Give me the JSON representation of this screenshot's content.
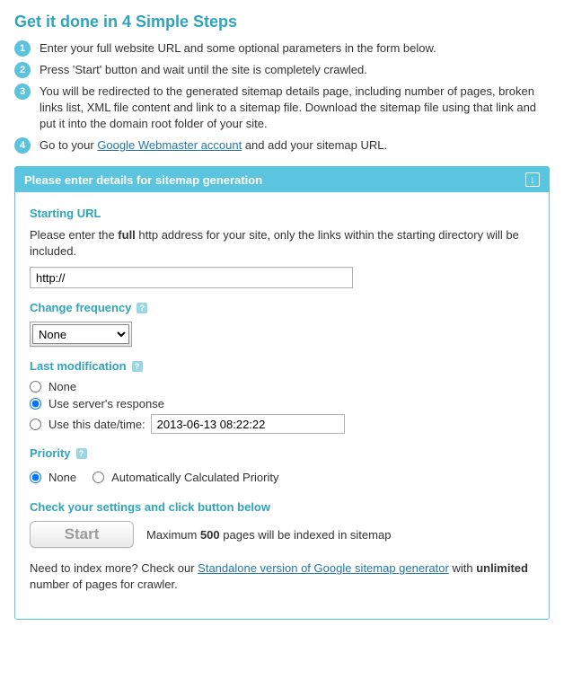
{
  "heading": "Get it done in 4 Simple Steps",
  "steps": {
    "s1": "Enter your full website URL and some optional parameters in the form below.",
    "s2": "Press 'Start' button and wait until the site is completely crawled.",
    "s3": "You will be redirected to the generated sitemap details page, including number of pages, broken links list, XML file content and link to a sitemap file. Download the sitemap file using that link and put it into the domain root folder of your site.",
    "s4_a": "Go to your ",
    "s4_link": "Google Webmaster account",
    "s4_b": " and add your sitemap URL."
  },
  "panel": {
    "title": "Please enter details for sitemap generation"
  },
  "form": {
    "starting_url_label": "Starting URL",
    "starting_url_desc_a": "Please enter the ",
    "starting_url_desc_bold": "full",
    "starting_url_desc_b": " http address for your site, only the links within the starting directory will be included.",
    "starting_url_value": "http://",
    "change_freq_label": "Change frequency",
    "change_freq_value": "None",
    "last_mod_label": "Last modification",
    "last_mod_none": "None",
    "last_mod_server": "Use server's response",
    "last_mod_date_label": "Use this date/time:",
    "last_mod_date_value": "2013-06-13 08:22:22",
    "priority_label": "Priority",
    "priority_none": "None",
    "priority_auto": "Automatically Calculated Priority",
    "check_label": "Check your settings and click button below",
    "start_label": "Start",
    "max_a": "Maximum ",
    "max_b": "500",
    "max_c": " pages will be indexed in sitemap",
    "note_a": "Need to index more? Check our ",
    "note_link": "Standalone version of Google sitemap generator",
    "note_b": " with ",
    "note_bold": "unlimited",
    "note_c": " number of pages for crawler."
  }
}
